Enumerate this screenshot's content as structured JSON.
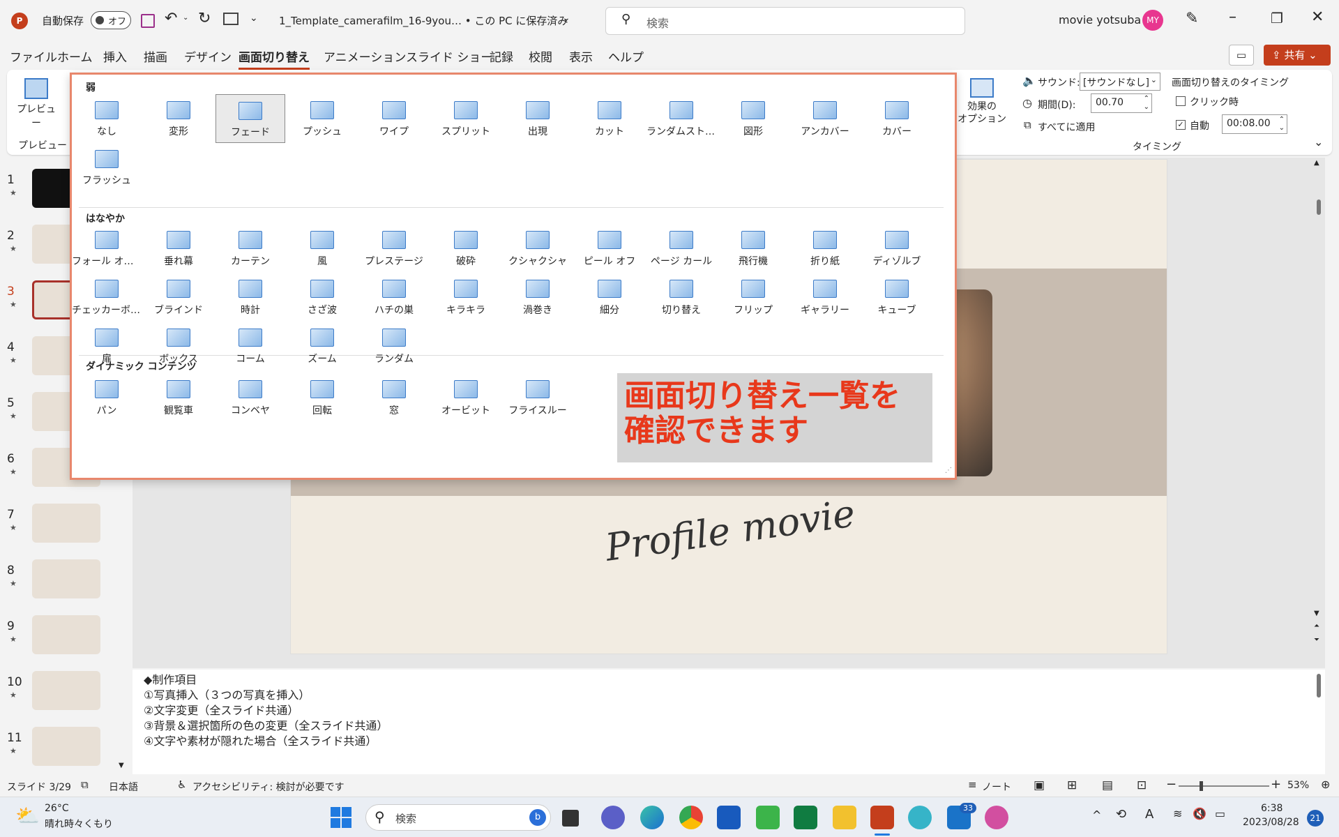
{
  "titlebar": {
    "autosave": "自動保存",
    "autosave_state": "オフ",
    "filename": "1_Template_camerafilm_16-9you… • この PC に保存済み",
    "search_placeholder": "検索",
    "user": "movie yotsuba",
    "avatar_initials": "MY"
  },
  "tabs": [
    "ファイル",
    "ホーム",
    "挿入",
    "描画",
    "デザイン",
    "画面切り替え",
    "アニメーション",
    "スライド ショー",
    "記録",
    "校閲",
    "表示",
    "ヘルプ"
  ],
  "share_label": "共有",
  "ribbon": {
    "preview_label": "プレビュー",
    "preview_group": "プレビュー",
    "effect_options": "効果の\nオプション",
    "sound_label": "サウンド:",
    "sound_value": "[サウンドなし]",
    "duration_label": "期間(D):",
    "duration_value": "00.70",
    "apply_all": "すべてに適用",
    "timing_title": "画面切り替えのタイミング",
    "on_click": "クリック時",
    "auto": "自動",
    "auto_value": "00:08.00",
    "timing_group": "タイミング"
  },
  "gallery": {
    "sections": [
      {
        "title": "弱",
        "items": [
          "なし",
          "変形",
          "フェード",
          "プッシュ",
          "ワイプ",
          "スプリット",
          "出現",
          "カット",
          "ランダムストラ...",
          "図形",
          "アンカバー",
          "カバー",
          "フラッシュ"
        ]
      },
      {
        "title": "はなやか",
        "items": [
          "フォール オー...",
          "垂れ幕",
          "カーテン",
          "風",
          "プレステージ",
          "破砕",
          "クシャクシャ",
          "ピール オフ",
          "ページ カール",
          "飛行機",
          "折り紙",
          "ディゾルブ",
          "チェッカーボード",
          "ブラインド",
          "時計",
          "さざ波",
          "ハチの巣",
          "キラキラ",
          "渦巻き",
          "細分",
          "切り替え",
          "フリップ",
          "ギャラリー",
          "キューブ",
          "扉",
          "ボックス",
          "コーム",
          "ズーム",
          "ランダム"
        ]
      },
      {
        "title": "ダイナミック コンテンツ",
        "items": [
          "パン",
          "観覧車",
          "コンベヤ",
          "回転",
          "窓",
          "オービット",
          "フライスルー"
        ]
      }
    ],
    "selected": "フェード"
  },
  "callout": "画面切り替え一覧を確認できます",
  "slide": {
    "script_text": "Profile movie"
  },
  "thumbnails": [
    "1",
    "2",
    "3",
    "4",
    "5",
    "6",
    "7",
    "8",
    "9",
    "10",
    "11"
  ],
  "notes": [
    "◆制作項目",
    "①写真挿入（３つの写真を挿入）",
    "②文字変更（全スライド共通）",
    "③背景＆選択箇所の色の変更（全スライド共通）",
    "④文字や素材が隠れた場合（全スライド共通）"
  ],
  "status": {
    "slide": "スライド 3/29",
    "lang": "日本語",
    "accessibility": "アクセシビリティ: 検討が必要です",
    "notes_btn": "ノート",
    "zoom": "53%"
  },
  "taskbar": {
    "weather_temp": "26°C",
    "weather_desc": "晴れ時々くもり",
    "search_placeholder": "検索",
    "time": "6:38",
    "date": "2023/08/28",
    "mail_badge": "33",
    "notif": "21"
  },
  "colors": {
    "accent": "#c43e1c",
    "callout_text": "#e8381b",
    "gallery_border": "#e8876c",
    "slide_bg": "#f2ece2",
    "photo_band": "#c8bcb0"
  }
}
